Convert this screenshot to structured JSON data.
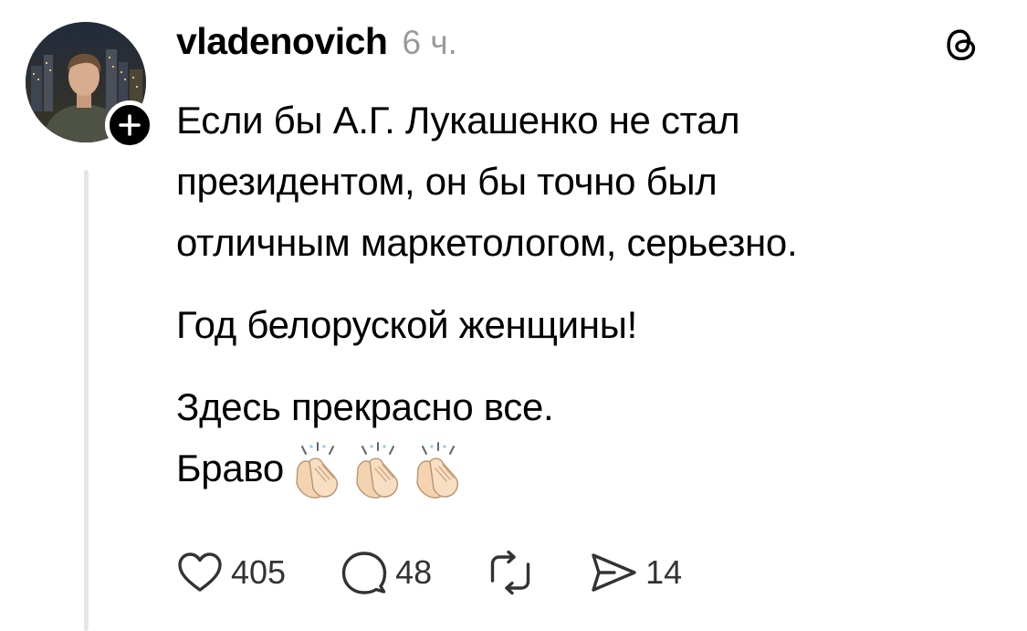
{
  "post": {
    "username": "vladenovich",
    "time": "6 ч.",
    "paragraphs": [
      "Если бы А.Г. Лукашенко не стал\nпрезидентом, он бы точно был\nотличным маркетологом, серьезно.",
      "Год белоруской женщины!",
      "Здесь прекрасно все."
    ],
    "last_line": "Браво",
    "emoji": [
      "clapping-hands",
      "clapping-hands",
      "clapping-hands"
    ]
  },
  "actions": {
    "likes": "405",
    "replies": "48",
    "shares": "14"
  },
  "icons": {
    "avatar": "profile-photo",
    "follow": "plus-icon",
    "brand": "threads-logo",
    "like": "heart-icon",
    "reply": "speech-bubble-icon",
    "repost": "repost-icon",
    "share": "send-icon"
  },
  "colors": {
    "text": "#000000",
    "muted": "#9a9a9a",
    "counts": "#333333",
    "thread_line": "#e6e6e6"
  }
}
